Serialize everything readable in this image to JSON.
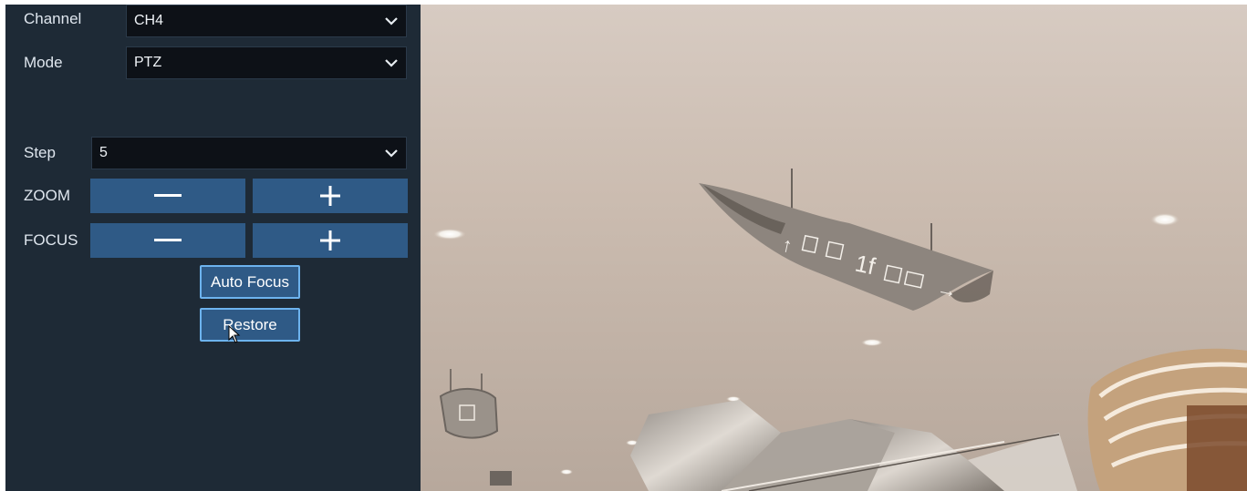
{
  "panel": {
    "channel": {
      "label": "Channel",
      "value": "CH4"
    },
    "mode": {
      "label": "Mode",
      "value": "PTZ"
    },
    "step": {
      "label": "Step",
      "value": "5"
    },
    "zoom": {
      "label": "ZOOM"
    },
    "focus": {
      "label": "FOCUS"
    },
    "auto_focus_label": "Auto Focus",
    "restore_label": "Restore"
  },
  "colors": {
    "panel_bg": "#1e2a36",
    "button_blue": "#2f5a86",
    "button_border": "#6db3ee",
    "select_bg": "#0d1117"
  },
  "icons": {
    "minus": "minus-icon",
    "plus": "plus-icon",
    "dropdown": "chevron-down-icon",
    "cursor": "mouse-pointer-icon"
  }
}
